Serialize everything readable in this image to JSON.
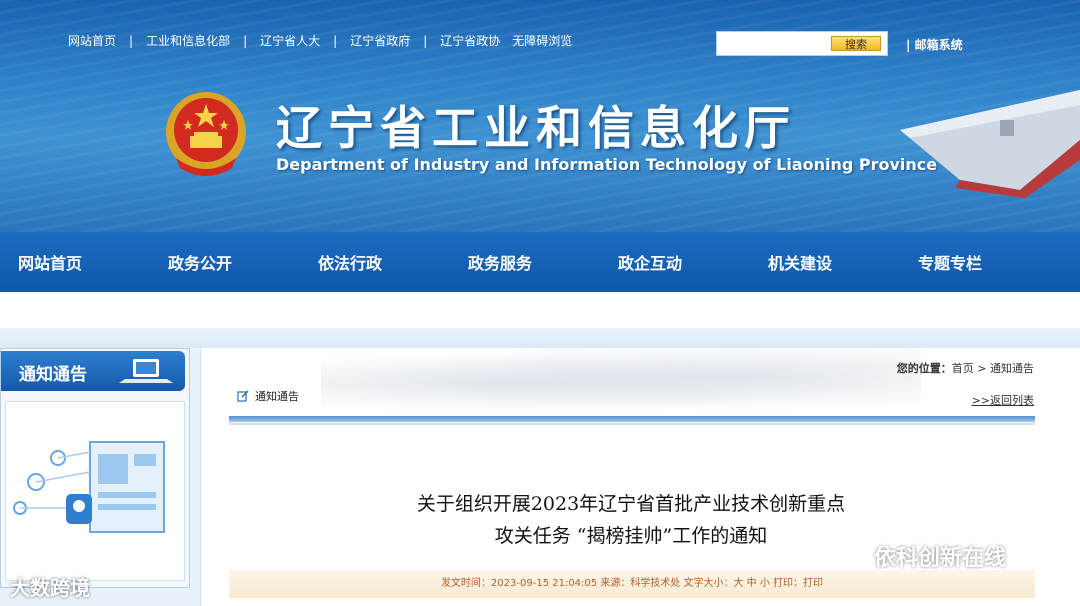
{
  "top_links": [
    "网站首页",
    "工业和信息化部",
    "辽宁省人大",
    "辽宁省政府",
    "辽宁省政协",
    "无障碍浏览"
  ],
  "search": {
    "button": "搜索",
    "placeholder": ""
  },
  "mail_link": "邮箱系统",
  "site_title_cn": "辽宁省工业和信息化厅",
  "site_title_en": "Department of Industry and Information Technology of Liaoning Province",
  "nav": [
    "网站首页",
    "政务公开",
    "依法行政",
    "政务服务",
    "政企互动",
    "机关建设",
    "专题专栏"
  ],
  "sidebar": {
    "heading": "通知通告"
  },
  "location": {
    "label": "您的位置：",
    "path": "首页 > 通知通告"
  },
  "section_title": "通知通告",
  "back_link": ">>返回列表",
  "article": {
    "title_line1": "关于组织开展2023年辽宁省首批产业技术创新重点",
    "title_line2": "攻关任务 “揭榜挂帅”工作的通知",
    "meta": "发文时间：2023-09-15 21:04:05 来源：科学技术处 文字大小：大 中 小     打印：打印"
  },
  "watermarks": {
    "right": "依科创新在线",
    "left": "大数跨境"
  },
  "colors": {
    "nav_bg": "#1b6bc1",
    "header_bg": "#2f82c9",
    "meta_text": "#b85c2a"
  }
}
